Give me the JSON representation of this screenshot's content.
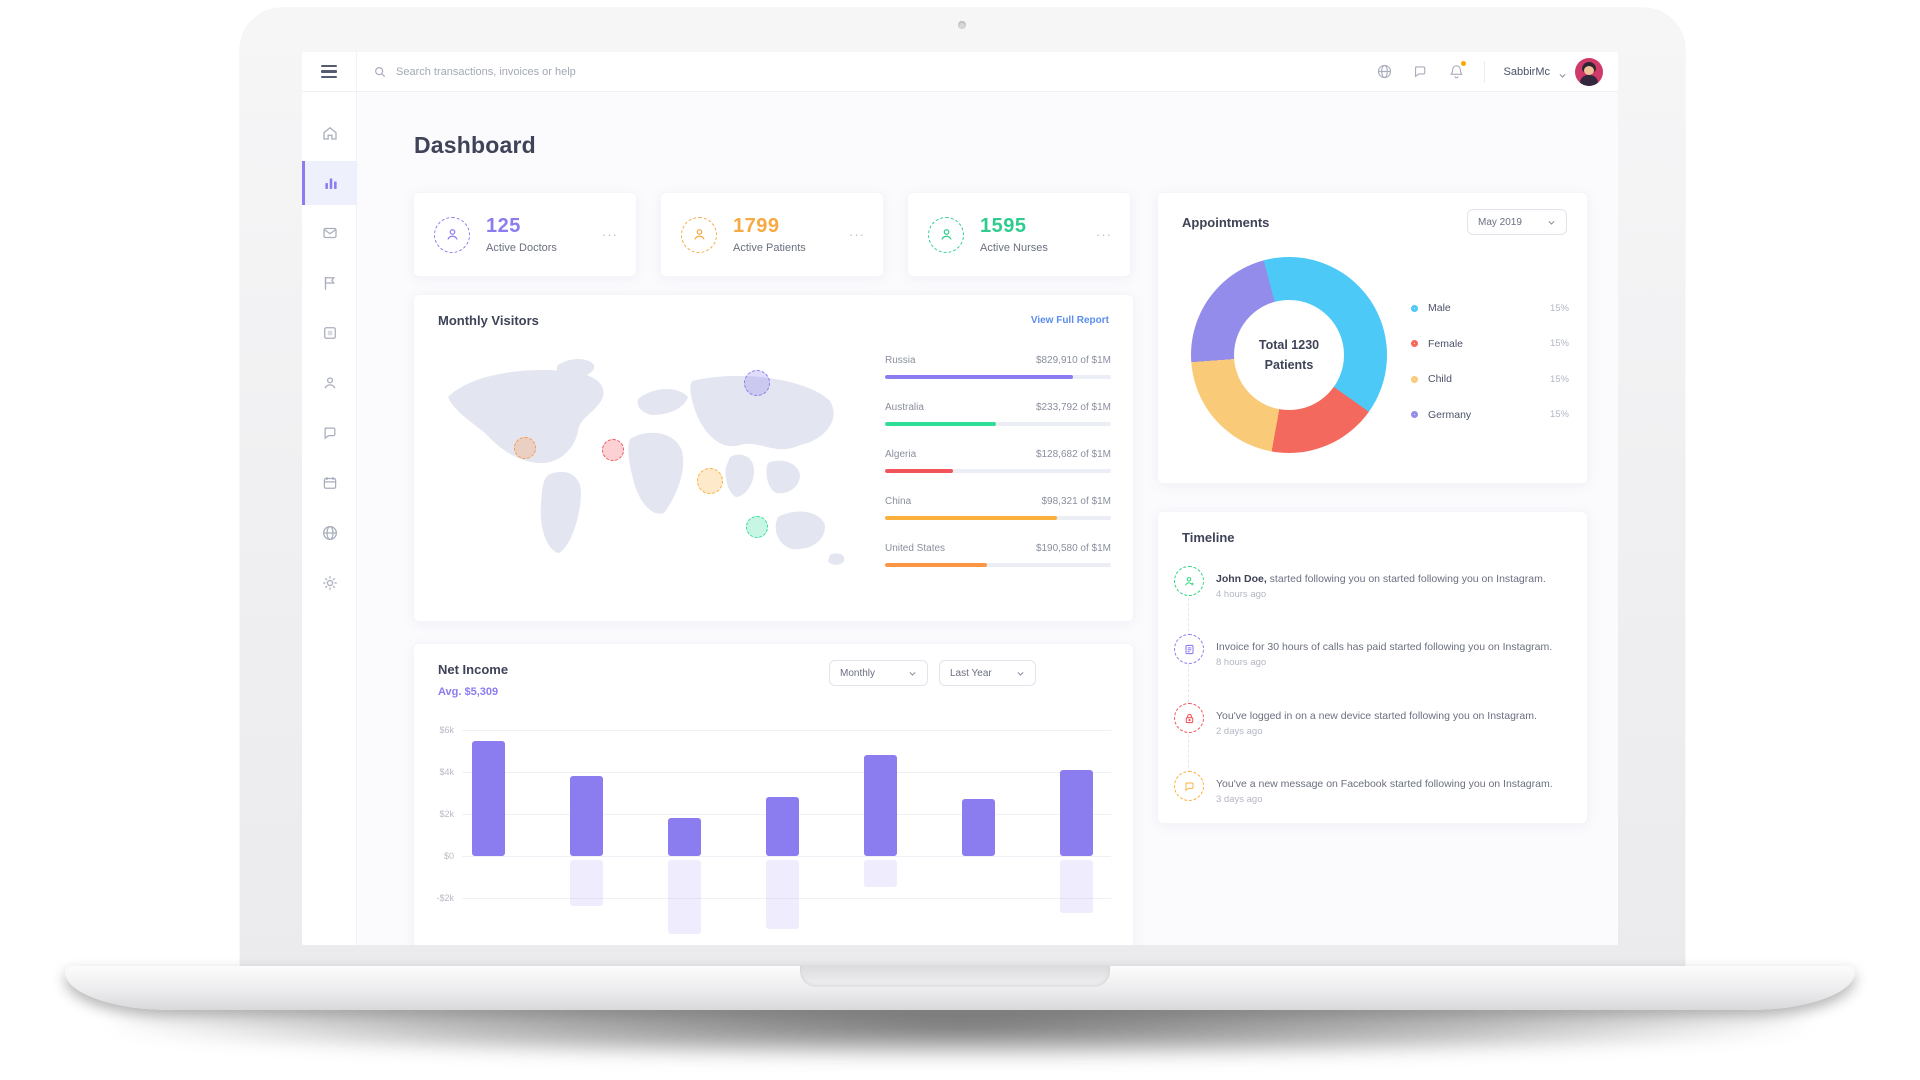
{
  "topbar": {
    "search_placeholder": "Search transactions, invoices or help",
    "user_name": "SabbirMc"
  },
  "page_title": "Dashboard",
  "stats": [
    {
      "value": "125",
      "label": "Active Doctors",
      "color": "#8b7cf0",
      "menu": "···"
    },
    {
      "value": "1799",
      "label": "Active Patients",
      "color": "#f7a944",
      "menu": "···"
    },
    {
      "value": "1595",
      "label": "Active Nurses",
      "color": "#2fcc8e",
      "menu": "···"
    }
  ],
  "monthly_visitors": {
    "title": "Monthly Visitors",
    "link_label": "View Full Report",
    "countries": [
      {
        "name": "Russia",
        "value": "$829,910 of $1M",
        "pct": 83,
        "color": "#8b7cf0"
      },
      {
        "name": "Australia",
        "value": "$233,792 of $1M",
        "pct": 49,
        "color": "#2ede98"
      },
      {
        "name": "Algeria",
        "value": "$128,682 of $1M",
        "pct": 30,
        "color": "#f2545b"
      },
      {
        "name": "China",
        "value": "$98,321 of $1M",
        "pct": 76,
        "color": "#fbb03b"
      },
      {
        "name": "United States",
        "value": "$190,580 of $1M",
        "pct": 45,
        "color": "#fd9644"
      }
    ],
    "map_markers": [
      {
        "country": "Russia",
        "x": 76,
        "y": 15,
        "size": 26,
        "color": "#8b7cf0"
      },
      {
        "country": "United States",
        "x": 22,
        "y": 42,
        "size": 22,
        "color": "#fd9644"
      },
      {
        "country": "Algeria",
        "x": 42.5,
        "y": 43,
        "size": 22,
        "color": "#f2545b"
      },
      {
        "country": "China",
        "x": 65,
        "y": 56,
        "size": 26,
        "color": "#fbb03b"
      },
      {
        "country": "Australia",
        "x": 76,
        "y": 75,
        "size": 22,
        "color": "#2ede98"
      }
    ]
  },
  "appointments": {
    "title": "Appointments",
    "period": "May 2019",
    "center_line1": "Total 1230",
    "center_line2": "Patients",
    "donut_start_deg": -15,
    "segments": [
      {
        "label": "Male",
        "pct_label": "15%",
        "sweep": 39,
        "color": "#4cc9f7"
      },
      {
        "label": "Female",
        "pct_label": "15%",
        "sweep": 18,
        "color": "#f4695e"
      },
      {
        "label": "Child",
        "pct_label": "15%",
        "sweep": 21,
        "color": "#f9cb78"
      },
      {
        "label": "Germany",
        "pct_label": "15%",
        "sweep": 22,
        "color": "#938ceb"
      }
    ]
  },
  "timeline": {
    "title": "Timeline",
    "events": [
      {
        "bold": "John Doe,",
        "text": " started following you on started following you on Instagram.",
        "time": "4 hours ago",
        "icon": "person-plus",
        "color": "#2ed580"
      },
      {
        "bold": "",
        "text": "Invoice for 30 hours of calls has paid started following you on Instagram.",
        "time": "8 hours ago",
        "icon": "invoice",
        "color": "#8b7cf0"
      },
      {
        "bold": "",
        "text": "You've logged in on a new device started following you on Instagram.",
        "time": "2 days ago",
        "icon": "lock",
        "color": "#f2545b"
      },
      {
        "bold": "",
        "text": "You've a new message on Facebook started following you on Instagram.",
        "time": "3 days ago",
        "icon": "chat",
        "color": "#fbb03b"
      }
    ]
  },
  "net_income": {
    "title": "Net Income",
    "avg_label": "Avg. $5,309",
    "filter1": "Monthly",
    "filter2": "Last Year",
    "chart": {
      "type": "bar",
      "y_ticks": [
        "$6k",
        "$4k",
        "$2k",
        "$0",
        "-$2k"
      ],
      "y_tick_values_k": [
        6,
        4,
        2,
        0,
        -2
      ],
      "values_k": [
        5.5,
        3.8,
        1.8,
        2.8,
        4.8,
        2.7,
        4.1
      ],
      "shadow_values_k": [
        0,
        -2.2,
        -3.5,
        -3.3,
        -1.3,
        0,
        -2.5
      ],
      "bar_color": "#8b7cf0"
    }
  },
  "sidebar": {
    "items": [
      {
        "icon": "home"
      },
      {
        "icon": "bar-chart",
        "active": true
      },
      {
        "icon": "mail"
      },
      {
        "icon": "flag"
      },
      {
        "icon": "window"
      },
      {
        "icon": "user"
      },
      {
        "icon": "chat"
      },
      {
        "icon": "calendar"
      },
      {
        "icon": "globe"
      },
      {
        "icon": "settings"
      }
    ]
  }
}
